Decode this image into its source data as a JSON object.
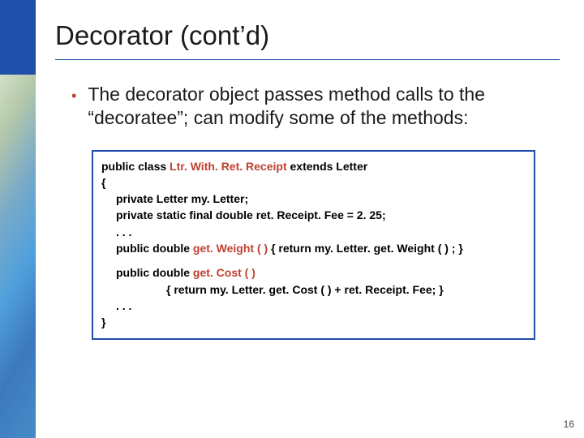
{
  "title": "Decorator (cont’d)",
  "bullet": "The decorator object passes method calls to the “decoratee”; can modify some of the methods:",
  "code": {
    "l1a": "public class ",
    "l1b": "Ltr. With. Ret. Receipt",
    "l1c": "  extends Letter",
    "l2": "{",
    "l3": "private Letter my. Letter;",
    "l4": "private static final double ret. Receipt. Fee = 2. 25;",
    "l5": ". . .",
    "l6a": "public double ",
    "l6b": "get. Weight ( )",
    "l6c": "   { return my. Letter. get. Weight ( ) ; }",
    "l7a": "public double ",
    "l7b": "get. Cost ( )",
    "l8": "{ return my. Letter. get. Cost ( ) + ret. Receipt. Fee; }",
    "l9": ". . .",
    "l10": "}"
  },
  "pageNumber": "16"
}
